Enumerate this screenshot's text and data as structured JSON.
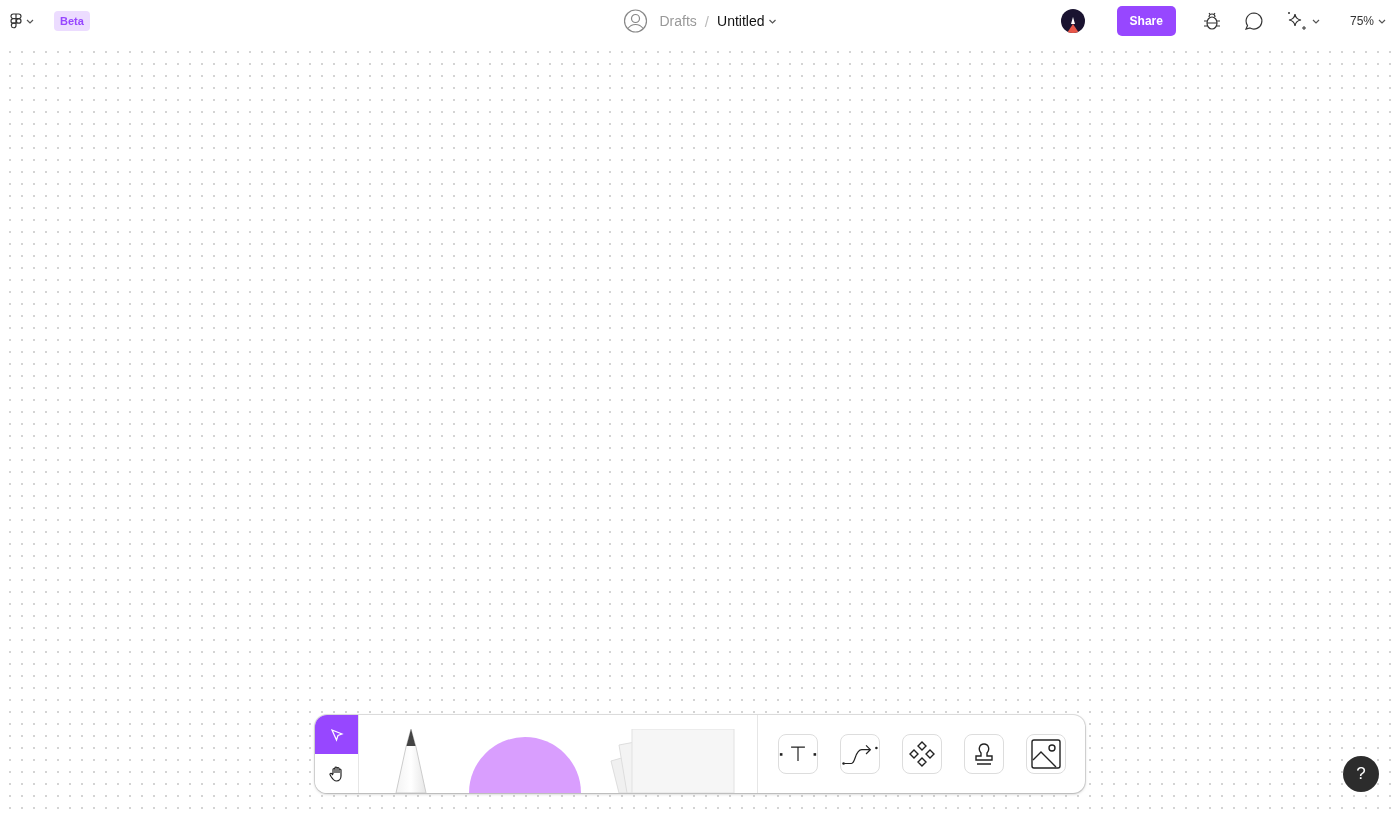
{
  "header": {
    "badge": "Beta",
    "breadcrumb": {
      "folder": "Drafts",
      "separator": "/",
      "file": "Untitled"
    },
    "share": "Share",
    "zoom": "75%"
  },
  "toolbar": {
    "modes": [
      {
        "kind": "select",
        "selected": true
      },
      {
        "kind": "hand",
        "selected": false
      }
    ],
    "tools": [
      {
        "kind": "text"
      },
      {
        "kind": "connector"
      },
      {
        "kind": "component"
      },
      {
        "kind": "stamp"
      },
      {
        "kind": "image"
      }
    ]
  },
  "help": "?"
}
